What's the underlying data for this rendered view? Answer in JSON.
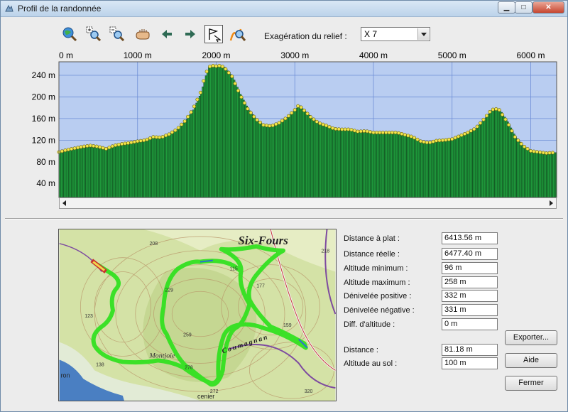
{
  "window": {
    "title": "Profil de la randonnée"
  },
  "titlebar_buttons": {
    "minimize": "▁",
    "maximize": "□",
    "close": "✕"
  },
  "toolbar": {
    "tools": [
      "globe-zoom-icon",
      "zoom-in-icon",
      "zoom-out-icon",
      "hand-pan-icon",
      "arrow-left-icon",
      "arrow-right-icon",
      "flag-select-icon",
      "route-zoom-icon"
    ],
    "relief_label": "Exagération du relief :",
    "relief_value": "X 7"
  },
  "colors": {
    "plot_bg": "#b9cdf1",
    "bar_fill": "#1f9a3c",
    "bar_stroke": "#0d3c18",
    "marker": "#f2e64a",
    "grid": "#6f8ed6",
    "route": "#33e021"
  },
  "chart_data": {
    "type": "bar",
    "x_unit": "m",
    "x_ticks": [
      0,
      1000,
      2000,
      3000,
      4000,
      5000,
      6000
    ],
    "x_tick_labels": [
      "0 m",
      "1000 m",
      "2000 m",
      "3000 m",
      "4000 m",
      "5000 m",
      "6000 m"
    ],
    "y_ticks": [
      40,
      80,
      120,
      160,
      200,
      240
    ],
    "y_tick_labels": [
      "40 m",
      "80 m",
      "120 m",
      "160 m",
      "200 m",
      "240 m"
    ],
    "xlim": [
      0,
      6330
    ],
    "ylim": [
      14,
      265
    ],
    "profile": [
      [
        0,
        98
      ],
      [
        100,
        102
      ],
      [
        200,
        105
      ],
      [
        300,
        108
      ],
      [
        400,
        110
      ],
      [
        500,
        108
      ],
      [
        600,
        104
      ],
      [
        700,
        110
      ],
      [
        800,
        113
      ],
      [
        900,
        115
      ],
      [
        1000,
        118
      ],
      [
        1100,
        120
      ],
      [
        1200,
        126
      ],
      [
        1300,
        125
      ],
      [
        1400,
        131
      ],
      [
        1500,
        140
      ],
      [
        1600,
        155
      ],
      [
        1700,
        176
      ],
      [
        1800,
        208
      ],
      [
        1850,
        235
      ],
      [
        1900,
        255
      ],
      [
        1950,
        258
      ],
      [
        2000,
        257
      ],
      [
        2050,
        258
      ],
      [
        2100,
        255
      ],
      [
        2200,
        238
      ],
      [
        2300,
        205
      ],
      [
        2400,
        178
      ],
      [
        2500,
        160
      ],
      [
        2600,
        148
      ],
      [
        2700,
        146
      ],
      [
        2800,
        152
      ],
      [
        2900,
        162
      ],
      [
        3000,
        176
      ],
      [
        3050,
        185
      ],
      [
        3100,
        178
      ],
      [
        3200,
        163
      ],
      [
        3300,
        152
      ],
      [
        3400,
        147
      ],
      [
        3500,
        141
      ],
      [
        3600,
        140
      ],
      [
        3700,
        140
      ],
      [
        3800,
        136
      ],
      [
        3900,
        137
      ],
      [
        4000,
        134
      ],
      [
        4100,
        134
      ],
      [
        4200,
        134
      ],
      [
        4300,
        134
      ],
      [
        4400,
        130
      ],
      [
        4500,
        126
      ],
      [
        4600,
        118
      ],
      [
        4700,
        115
      ],
      [
        4800,
        119
      ],
      [
        4900,
        120
      ],
      [
        5000,
        122
      ],
      [
        5100,
        128
      ],
      [
        5200,
        134
      ],
      [
        5300,
        142
      ],
      [
        5400,
        158
      ],
      [
        5500,
        176
      ],
      [
        5550,
        178
      ],
      [
        5600,
        176
      ],
      [
        5700,
        154
      ],
      [
        5800,
        126
      ],
      [
        5900,
        110
      ],
      [
        6000,
        100
      ],
      [
        6100,
        98
      ],
      [
        6200,
        96
      ],
      [
        6300,
        97
      ]
    ]
  },
  "map": {
    "title": "Six-Fours",
    "labels": [
      "Montjoie",
      "Coumagnan",
      "ron",
      "cenier"
    ],
    "spot_heights": [
      "208",
      "218",
      "115",
      "177",
      "229",
      "123",
      "159",
      "259",
      "278",
      "138",
      "272",
      "320"
    ]
  },
  "stats": [
    {
      "label": "Distance à plat :",
      "value": "6413.56 m"
    },
    {
      "label": "Distance réelle :",
      "value": "6477.40 m"
    },
    {
      "label": "Altitude minimum :",
      "value": "96 m"
    },
    {
      "label": "Altitude maximum :",
      "value": "258 m"
    },
    {
      "label": "Dénivelée positive :",
      "value": "332 m"
    },
    {
      "label": "Dénivelée négative :",
      "value": "331 m"
    },
    {
      "label": "Diff. d'altitude :",
      "value": "0 m"
    }
  ],
  "cursor": [
    {
      "label": "Distance :",
      "value": "81.18 m"
    },
    {
      "label": "Altitude au sol :",
      "value": "100 m"
    }
  ],
  "buttons": {
    "export": "Exporter...",
    "help": "Aide",
    "close": "Fermer"
  }
}
